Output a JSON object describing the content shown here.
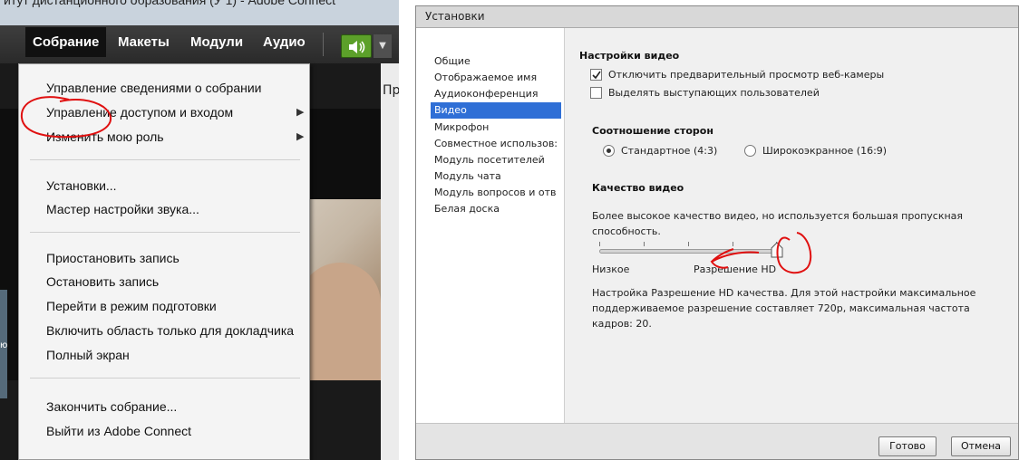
{
  "left": {
    "window_title": "итут дистанционного образования (У 1) - Adobe Connect",
    "menubar": {
      "meeting": "Собрание",
      "layouts": "Макеты",
      "modules": "Модули",
      "audio": "Аудио"
    },
    "menu_items": {
      "manage_meeting_info": "Управление сведениями о собрании",
      "manage_access": "Управление доступом и входом",
      "change_role": "Изменить мою роль",
      "preferences": "Установки...",
      "audio_wizard": "Мастер настройки звука...",
      "pause_recording": "Приостановить запись",
      "stop_recording": "Остановить запись",
      "prepare_mode": "Перейти в режим подготовки",
      "presenter_only": "Включить область только для докладчика",
      "full_screen": "Полный экран",
      "end_meeting": "Закончить собрание...",
      "exit": "Выйти из Adobe Connect"
    },
    "background": {
      "pane_tab_label": "Пр",
      "side_letter": "ю"
    },
    "speaker_color": "#5ca02a"
  },
  "dialog": {
    "title": "Установки",
    "nav": [
      "Общие",
      "Отображаемое имя",
      "Аудиоконференция",
      "Видео",
      "Микрофон",
      "Совместное использов:",
      "Модуль посетителей",
      "Модуль чата",
      "Модуль вопросов и отв",
      "Белая доска"
    ],
    "selected_nav": "Видео",
    "video_settings": {
      "heading": "Настройки видео",
      "disable_preview": {
        "label": "Отключить предварительный просмотр веб-камеры",
        "checked": true
      },
      "highlight_speakers": {
        "label": "Выделять выступающих пользователей",
        "checked": false
      }
    },
    "aspect_ratio": {
      "heading": "Соотношение сторон",
      "standard": {
        "label": "Стандартное (4:3)",
        "selected": true
      },
      "wide": {
        "label": "Широкоэкранное (16:9)",
        "selected": false
      }
    },
    "quality": {
      "heading": "Качество видео",
      "description": "Более высокое качество видео, но используется большая пропускная способность.",
      "low_label": "Низкое",
      "hd_label": "Разрешение HD",
      "level": 1.0,
      "note": "Настройка Разрешение HD качества. Для этой настройки максимальное поддерживаемое разрешение составляет 720p, максимальная частота кадров: 20."
    },
    "buttons": {
      "ok": "Готово",
      "cancel": "Отмена"
    },
    "accent": "#2f6fd6",
    "annotation_color": "#e01010"
  }
}
